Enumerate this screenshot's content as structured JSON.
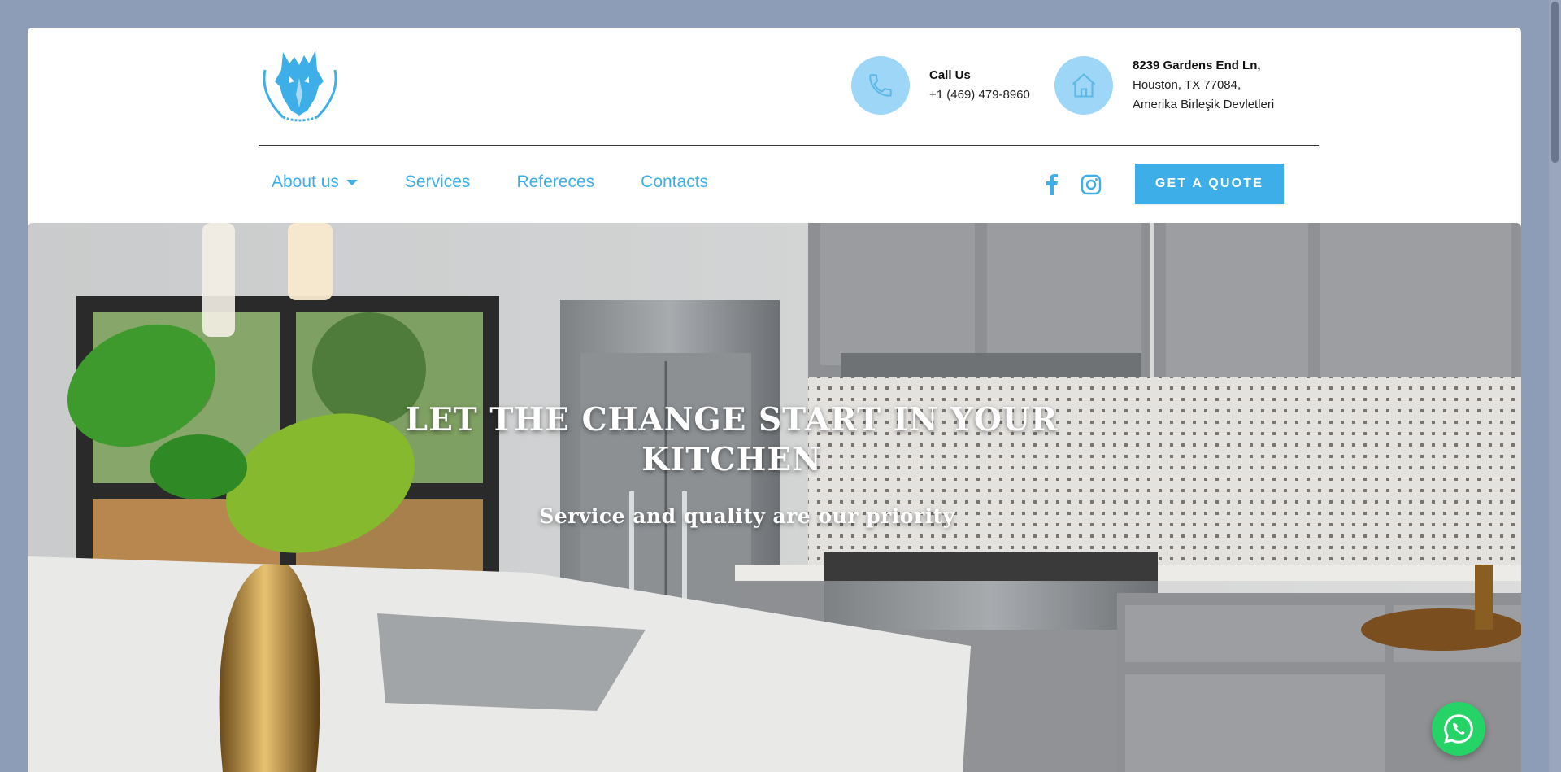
{
  "header": {
    "logo_alt": "YOUNG WOLVES REMODEL",
    "phone": {
      "label": "Call Us",
      "number": "+1 (469) 479-8960",
      "icon": "phone-icon"
    },
    "address": {
      "line1": "8239 Gardens End Ln,",
      "line2": "Houston, TX 77084,",
      "line3": "Amerika Birleşik Devletleri",
      "icon": "home-icon"
    }
  },
  "nav": {
    "items": [
      {
        "label": "About us",
        "has_dropdown": true
      },
      {
        "label": "Services"
      },
      {
        "label": "Refereces"
      },
      {
        "label": "Contacts"
      }
    ],
    "social": [
      "facebook-icon",
      "instagram-icon"
    ],
    "quote_button": "GET A QUOTE"
  },
  "hero": {
    "title": "LET THE CHANGE START IN YOUR KITCHEN",
    "subtitle": "Service and quality are our priority"
  },
  "colors": {
    "accent": "#3eaee8",
    "accent_light": "#9dd6f6",
    "page_bg": "#8e9db7",
    "whatsapp": "#25d366"
  }
}
